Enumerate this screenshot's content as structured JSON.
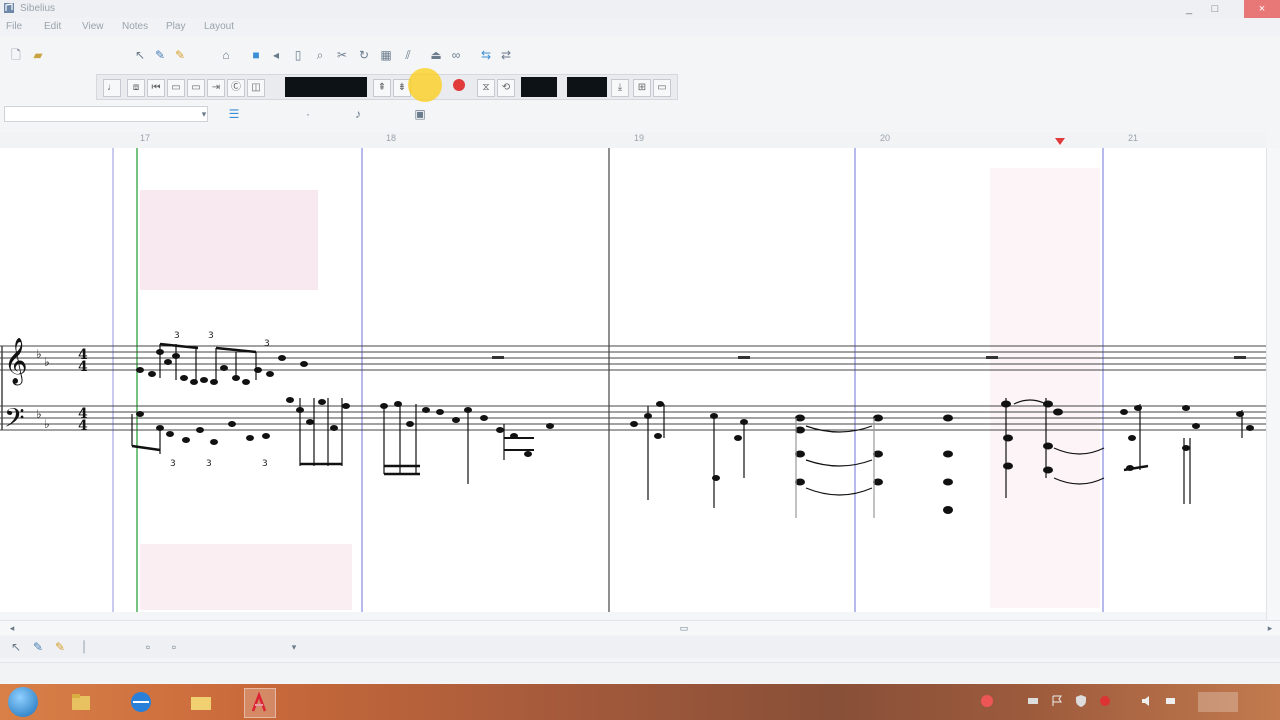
{
  "window": {
    "title": "Sibelius",
    "controls": [
      "_",
      "□",
      "×"
    ]
  },
  "menu": {
    "items": [
      "File",
      "Edit",
      "View",
      "Notes",
      "Play",
      "Layout"
    ]
  },
  "toolbar": {
    "tools": [
      "new-icon",
      "open-icon",
      "pointer-icon",
      "pencil-icon",
      "eraser-icon",
      "glue-icon",
      "mute-icon",
      "speaker-icon",
      "quantize-icon",
      "zoom-icon",
      "scissors-icon",
      "loop-icon",
      "grid-icon",
      "split-icon",
      "metronome-icon",
      "link-icon",
      "arrow-left-icon",
      "arrow-right-icon"
    ]
  },
  "transport": {
    "buttons": [
      "note-icon",
      "bar-icon",
      "rewind-icon",
      "stop-icon",
      "play-icon",
      "forward-icon",
      "cycle-icon",
      "click-icon",
      "record-icon",
      "punch-in-icon",
      "punch-out-icon",
      "sync-icon",
      "loop-icon",
      "marker-icon"
    ]
  },
  "track_selector": {
    "value": "",
    "placeholder": ""
  },
  "score": {
    "measures": [
      "17",
      "18",
      "19",
      "20",
      "21"
    ],
    "instrument": "",
    "clefs": {
      "treble": "𝄞",
      "bass": "𝄢"
    },
    "time_signature": {
      "numerator": "4",
      "denominator": "4"
    }
  },
  "bottom_toolbar": {
    "zoom_label": "",
    "status_middle": "",
    "status_right": ""
  },
  "colors": {
    "playhead": "#1e9b2a",
    "bar_line_blue": "#9b9df0",
    "selection_pink": "#f7e6ee",
    "record_red": "#e03a3a"
  }
}
